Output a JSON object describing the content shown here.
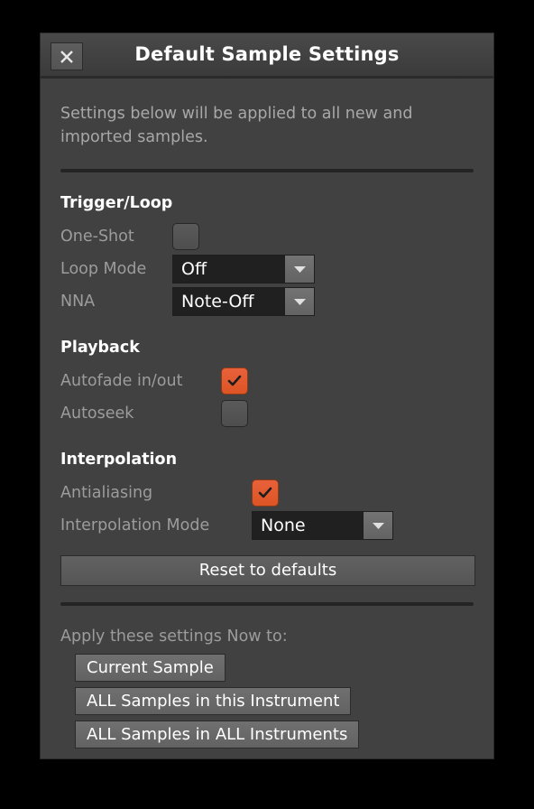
{
  "window": {
    "title": "Default Sample Settings",
    "close_icon": "close-icon"
  },
  "intro_text": "Settings below will be applied to all new and imported samples.",
  "accent_color": "#dd5524",
  "sections": {
    "trigger_loop": {
      "title": "Trigger/Loop",
      "one_shot": {
        "label": "One-Shot",
        "checked": false
      },
      "loop_mode": {
        "label": "Loop Mode",
        "value": "Off"
      },
      "nna": {
        "label": "NNA",
        "value": "Note-Off"
      }
    },
    "playback": {
      "title": "Playback",
      "autofade": {
        "label": "Autofade in/out",
        "checked": true
      },
      "autoseek": {
        "label": "Autoseek",
        "checked": false
      }
    },
    "interpolation": {
      "title": "Interpolation",
      "antialiasing": {
        "label": "Antialiasing",
        "checked": true
      },
      "interpolation_mode": {
        "label": "Interpolation Mode",
        "value": "None"
      }
    }
  },
  "reset_button": {
    "label": "Reset to defaults"
  },
  "apply": {
    "label": "Apply these settings Now to:",
    "buttons": [
      {
        "label": "Current Sample"
      },
      {
        "label": "ALL Samples in this Instrument"
      },
      {
        "label": "ALL Samples in ALL Instruments"
      }
    ]
  }
}
